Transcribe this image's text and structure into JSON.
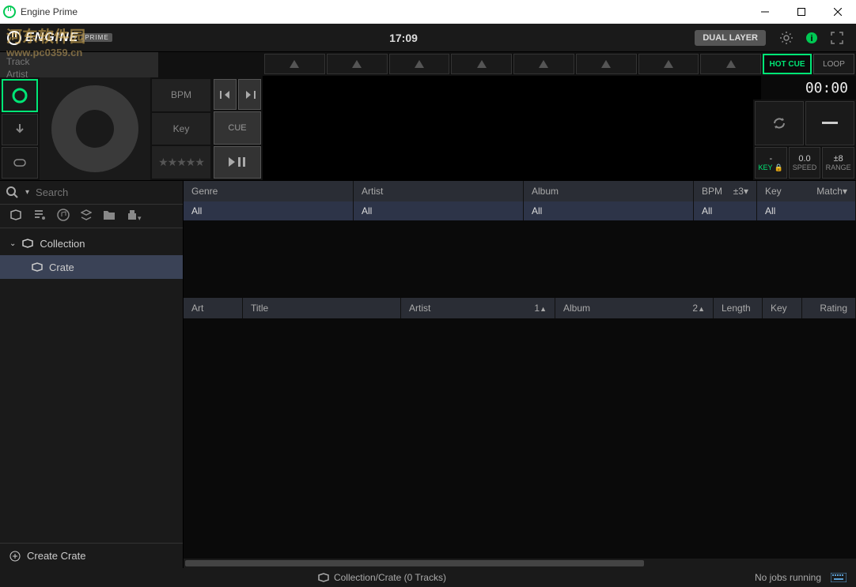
{
  "window": {
    "title": "Engine Prime"
  },
  "topbar": {
    "logo_text": "ENGINE",
    "logo_badge": "PRIME",
    "time": "17:09",
    "dual_layer": "DUAL LAYER"
  },
  "deck": {
    "track_label": "Track",
    "artist_label": "Artist",
    "bpm_label": "BPM",
    "key_label": "Key",
    "cue_label": "CUE",
    "hotcue": "HOT CUE",
    "loop": "LOOP",
    "time_counter": "00:00",
    "params": {
      "key": {
        "value": "-",
        "label": "KEY"
      },
      "speed": {
        "value": "0.0",
        "label": "SPEED"
      },
      "range": {
        "value": "±8",
        "label": "RANGE"
      }
    }
  },
  "search": {
    "placeholder": "Search"
  },
  "filters": {
    "genre": {
      "header": "Genre",
      "value": "All"
    },
    "artist": {
      "header": "Artist",
      "value": "All"
    },
    "album": {
      "header": "Album",
      "value": "All"
    },
    "bpm": {
      "header": "BPM",
      "tolerance": "±3",
      "value": "All"
    },
    "key": {
      "header": "Key",
      "match": "Match",
      "value": "All"
    }
  },
  "tree": {
    "collection": "Collection",
    "crate": "Crate",
    "create": "Create Crate"
  },
  "columns": {
    "art": "Art",
    "title": "Title",
    "artist": "Artist",
    "artist_sort": "1",
    "album": "Album",
    "album_sort": "2",
    "length": "Length",
    "key": "Key",
    "rating": "Rating"
  },
  "status": {
    "path": "Collection/Crate (0 Tracks)",
    "jobs": "No jobs running"
  },
  "watermark": {
    "cn": "河东软件园",
    "url": "www.pc0359.cn"
  }
}
